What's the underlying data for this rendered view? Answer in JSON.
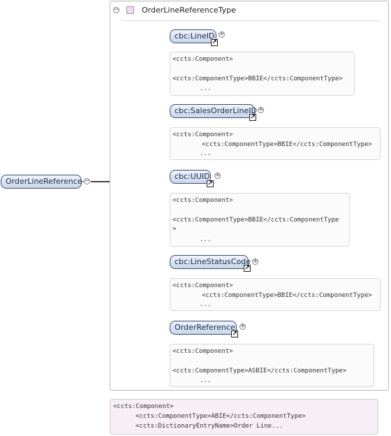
{
  "root": {
    "label": "OrderLineReference"
  },
  "type": {
    "title": "OrderLineReferenceType"
  },
  "elements": [
    {
      "label": "cbc:LineID",
      "ann": [
        "<ccts:Component>",
        "<ccts:ComponentType>BBIE</ccts:ComponentType>",
        "..."
      ]
    },
    {
      "label": "cbc:SalesOrderLineID",
      "ann": [
        "<ccts:Component>",
        "<ccts:ComponentType>BBIE</ccts:ComponentType>",
        "..."
      ]
    },
    {
      "label": "cbc:UUID",
      "ann": [
        "<ccts:Component>",
        "<ccts:ComponentType>BBIE</ccts:ComponentType",
        ">",
        "..."
      ]
    },
    {
      "label": "cbc:LineStatusCode",
      "ann": [
        "<ccts:Component>",
        "<ccts:ComponentType>BBIE</ccts:ComponentType>",
        "..."
      ]
    },
    {
      "label": "OrderReference",
      "ann": [
        "<ccts:Component>",
        "<ccts:ComponentType>ASBIE</ccts:ComponentType>",
        "..."
      ]
    }
  ],
  "bottom_annotation": [
    "<ccts:Component>",
    "<ccts:ComponentType>ABIE</ccts:ComponentType>",
    "<ccts:DictionaryEntryName>Order Line..."
  ]
}
